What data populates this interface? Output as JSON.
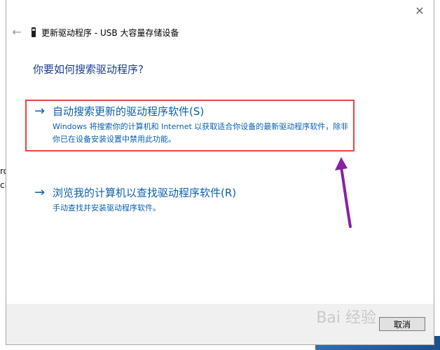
{
  "background": {
    "text_lines": [
      "ro",
      "ci"
    ]
  },
  "dialog": {
    "close_glyph": "✕",
    "back_glyph": "←",
    "title": "更新驱动程序 - USB 大容量存储设备",
    "heading": "你要如何搜索驱动程序?",
    "options": [
      {
        "title": "自动搜索更新的驱动程序软件(S)",
        "description": "Windows 将搜索你的计算机和 Internet 以获取适合你设备的最新驱动程序软件，除非你已在设备安装设置中禁用此功能。"
      },
      {
        "title": "浏览我的计算机以查找驱动程序软件(R)",
        "description": "手动查找并安装驱动程序软件。"
      }
    ],
    "arrow_glyph": "→",
    "cancel_label": "取消"
  },
  "watermark": "Bai 经验",
  "colors": {
    "link_blue": "#0b5fb1",
    "heading_blue": "#1a3e8c",
    "highlight_red": "#e84545",
    "annotation_purple": "#8a1fa5"
  }
}
